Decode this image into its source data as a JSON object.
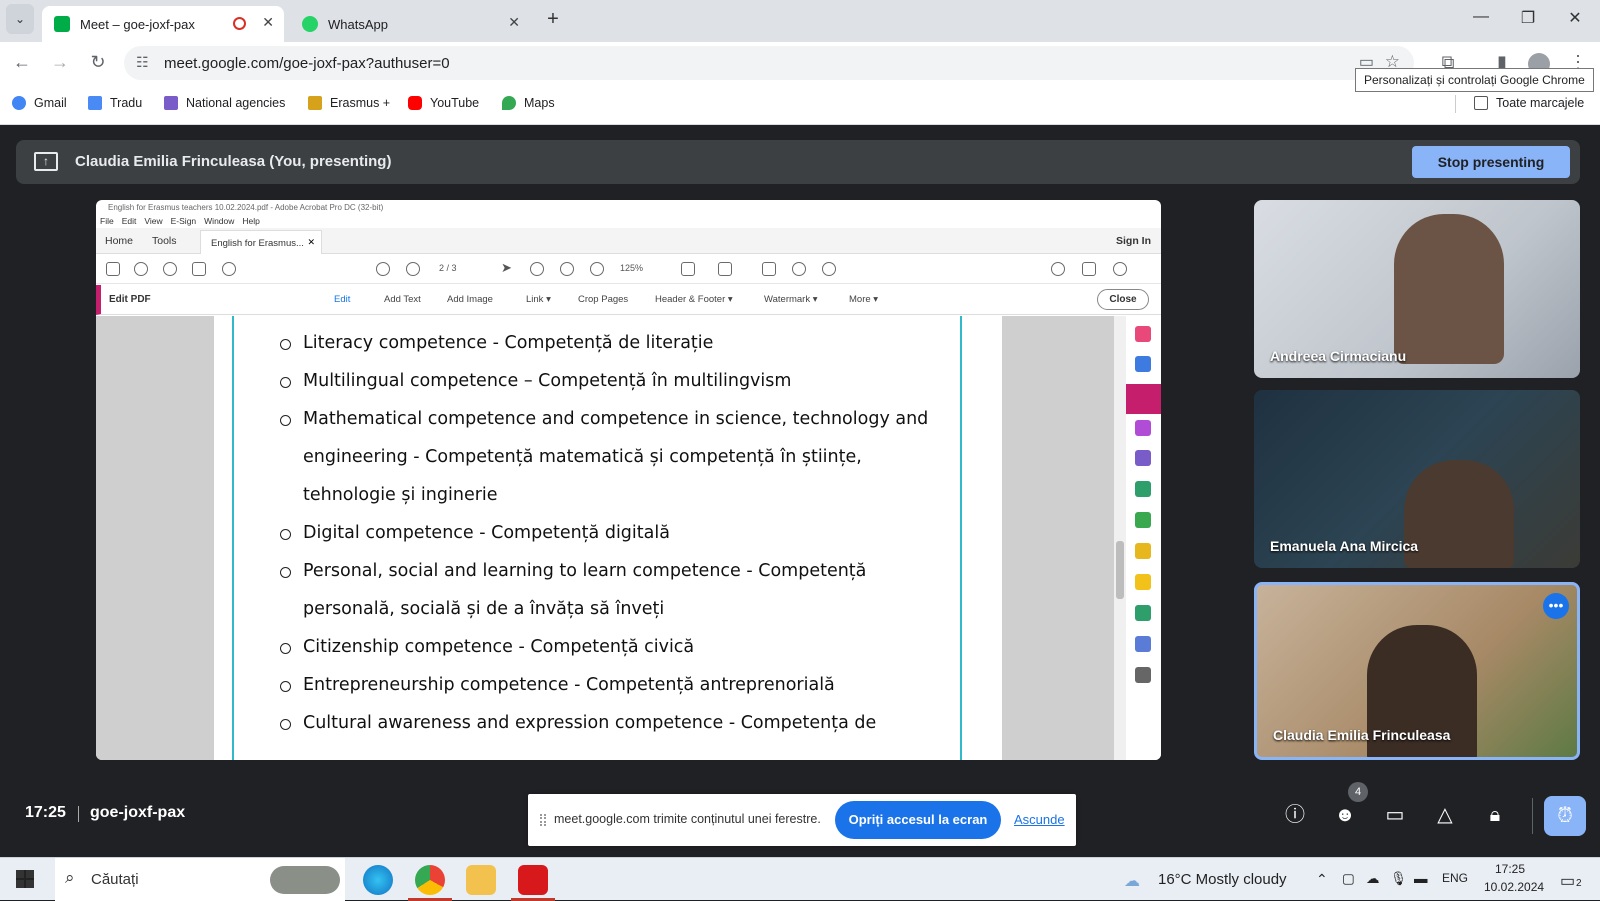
{
  "browser": {
    "tabs": [
      {
        "label": "Meet – goe-joxf-pax",
        "active": true
      },
      {
        "label": "WhatsApp",
        "active": false
      }
    ],
    "url": "meet.google.com/goe-joxf-pax?authuser=0",
    "tooltip": "Personalizați și controlați Google Chrome",
    "bookmarks": [
      "Gmail",
      "Tradu",
      "National agencies",
      "Erasmus +",
      "YouTube",
      "Maps"
    ],
    "all_bookmarks": "Toate marcajele"
  },
  "meet": {
    "presenting_banner": "Claudia Emilia Frinculeasa (You, presenting)",
    "stop_presenting": "Stop presenting",
    "time": "17:25",
    "meeting_code": "goe-joxf-pax",
    "participants_count": "4",
    "participants": [
      {
        "name": "Andreea Cirmacianu"
      },
      {
        "name": "Emanuela Ana Mircica"
      },
      {
        "name": "Claudia Emilia Frinculeasa"
      }
    ],
    "share_notice": {
      "text": "meet.google.com trimite conținutul unei ferestre.",
      "stop_button": "Opriți accesul la ecran",
      "hide": "Ascunde"
    }
  },
  "acrobat": {
    "title": "English for Erasmus teachers 10.02.2024.pdf - Adobe Acrobat Pro DC (32-bit)",
    "menu": [
      "File",
      "Edit",
      "View",
      "E-Sign",
      "Window",
      "Help"
    ],
    "tabs": {
      "home": "Home",
      "tools": "Tools",
      "doc": "English for Erasmus...",
      "signin": "Sign In"
    },
    "page_indicator": "2  /  3",
    "zoom": "125%",
    "edit_bar": {
      "label": "Edit PDF",
      "tools": [
        "Edit",
        "Add Text",
        "Add Image",
        "Link ▾",
        "Crop Pages",
        "Header & Footer ▾",
        "Watermark ▾",
        "More ▾"
      ],
      "close": "Close"
    },
    "list_items": [
      "Literacy competence - Competență de literație",
      "Multilingual competence – Competență în multilingvism",
      "Mathematical competence and competence in science, technology and engineering - Competență matematică și competență în științe, tehnologie și inginerie",
      "Digital competence - Competență digitală",
      "Personal, social and learning to learn competence - Competență personală, socială și de a învăța să înveți",
      "Citizenship competence - Competență civică",
      "Entrepreneurship competence - Competență antreprenorială",
      "Cultural awareness and expression competence - Competența de"
    ]
  },
  "taskbar": {
    "search": "Căutați",
    "weather": "16°C  Mostly cloudy",
    "lang": "ENG",
    "time": "17:25",
    "date": "10.02.2024",
    "notif": "2"
  }
}
